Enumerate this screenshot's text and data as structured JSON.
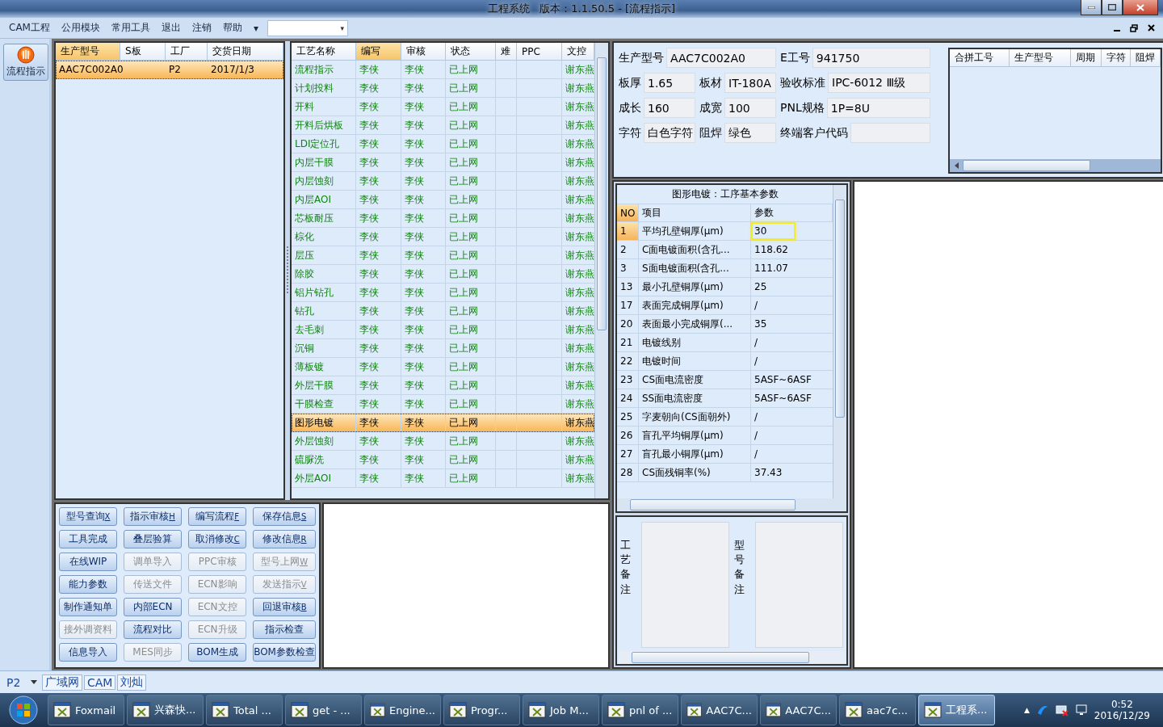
{
  "window": {
    "title": "工程系统   版本：1.1.50.5 - [流程指示]"
  },
  "menu": {
    "items": [
      "CAM工程",
      "公用模块",
      "常用工具",
      "退出",
      "注销",
      "帮助"
    ],
    "overflow": "▾",
    "combo_arrow": "▾"
  },
  "side_toolbar": {
    "button": "流程指示",
    "selected": true
  },
  "orders": {
    "columns": [
      "生产型号",
      "S板",
      "工厂",
      "交货日期"
    ],
    "rows": [
      {
        "cells": [
          "AAC7C002A0",
          "",
          "P2",
          "2017/1/3"
        ],
        "selected": true
      }
    ]
  },
  "processes": {
    "columns": [
      "工艺名称",
      "编写",
      "审核",
      "状态",
      "难",
      "PPC",
      "文控"
    ],
    "rows": [
      {
        "cells": [
          "流程指示",
          "李侠",
          "李侠",
          "已上网",
          "",
          "",
          "谢东燕"
        ],
        "selected": false
      },
      {
        "cells": [
          "计划投料",
          "李侠",
          "李侠",
          "已上网",
          "",
          "",
          "谢东燕"
        ],
        "selected": false
      },
      {
        "cells": [
          "开料",
          "李侠",
          "李侠",
          "已上网",
          "",
          "",
          "谢东燕"
        ],
        "selected": false
      },
      {
        "cells": [
          "开料后烘板",
          "李侠",
          "李侠",
          "已上网",
          "",
          "",
          "谢东燕"
        ],
        "selected": false
      },
      {
        "cells": [
          "LDI定位孔",
          "李侠",
          "李侠",
          "已上网",
          "",
          "",
          "谢东燕"
        ],
        "selected": false
      },
      {
        "cells": [
          "内层干膜",
          "李侠",
          "李侠",
          "已上网",
          "",
          "",
          "谢东燕"
        ],
        "selected": false
      },
      {
        "cells": [
          "内层蚀刻",
          "李侠",
          "李侠",
          "已上网",
          "",
          "",
          "谢东燕"
        ],
        "selected": false
      },
      {
        "cells": [
          "内层AOI",
          "李侠",
          "李侠",
          "已上网",
          "",
          "",
          "谢东燕"
        ],
        "selected": false
      },
      {
        "cells": [
          "芯板耐压",
          "李侠",
          "李侠",
          "已上网",
          "",
          "",
          "谢东燕"
        ],
        "selected": false
      },
      {
        "cells": [
          "棕化",
          "李侠",
          "李侠",
          "已上网",
          "",
          "",
          "谢东燕"
        ],
        "selected": false
      },
      {
        "cells": [
          "层压",
          "李侠",
          "李侠",
          "已上网",
          "",
          "",
          "谢东燕"
        ],
        "selected": false
      },
      {
        "cells": [
          "除胶",
          "李侠",
          "李侠",
          "已上网",
          "",
          "",
          "谢东燕"
        ],
        "selected": false
      },
      {
        "cells": [
          "铝片钻孔",
          "李侠",
          "李侠",
          "已上网",
          "",
          "",
          "谢东燕"
        ],
        "selected": false
      },
      {
        "cells": [
          "钻孔",
          "李侠",
          "李侠",
          "已上网",
          "",
          "",
          "谢东燕"
        ],
        "selected": false
      },
      {
        "cells": [
          "去毛刺",
          "李侠",
          "李侠",
          "已上网",
          "",
          "",
          "谢东燕"
        ],
        "selected": false
      },
      {
        "cells": [
          "沉铜",
          "李侠",
          "李侠",
          "已上网",
          "",
          "",
          "谢东燕"
        ],
        "selected": false
      },
      {
        "cells": [
          "薄板镀",
          "李侠",
          "李侠",
          "已上网",
          "",
          "",
          "谢东燕"
        ],
        "selected": false
      },
      {
        "cells": [
          "外层干膜",
          "李侠",
          "李侠",
          "已上网",
          "",
          "",
          "谢东燕"
        ],
        "selected": false
      },
      {
        "cells": [
          "干膜检查",
          "李侠",
          "李侠",
          "已上网",
          "",
          "",
          "谢东燕"
        ],
        "selected": false
      },
      {
        "cells": [
          "图形电镀",
          "李侠",
          "李侠",
          "已上网",
          "",
          "",
          "谢东燕"
        ],
        "selected": true
      },
      {
        "cells": [
          "外层蚀刻",
          "李侠",
          "李侠",
          "已上网",
          "",
          "",
          "谢东燕"
        ],
        "selected": false
      },
      {
        "cells": [
          "硫脲洗",
          "李侠",
          "李侠",
          "已上网",
          "",
          "",
          "谢东燕"
        ],
        "selected": false
      },
      {
        "cells": [
          "外层AOI",
          "李侠",
          "李侠",
          "已上网",
          "",
          "",
          "谢东燕"
        ],
        "selected": false
      }
    ]
  },
  "actions": [
    {
      "label": "型号查询",
      "hotkey": "X",
      "disabled": false
    },
    {
      "label": "指示审核",
      "hotkey": "H",
      "disabled": false
    },
    {
      "label": "编写流程",
      "hotkey": "F",
      "disabled": false
    },
    {
      "label": "保存信息",
      "hotkey": "S",
      "disabled": false
    },
    {
      "label": "工具完成",
      "disabled": false
    },
    {
      "label": "叠层验算",
      "disabled": false
    },
    {
      "label": "取消修改",
      "hotkey": "C",
      "disabled": false
    },
    {
      "label": "修改信息",
      "hotkey": "R",
      "disabled": false
    },
    {
      "label": "在线WIP",
      "disabled": false
    },
    {
      "label": "调单导入",
      "disabled": true
    },
    {
      "label": "PPC审核",
      "disabled": true
    },
    {
      "label": "型号上网",
      "hotkey": "W",
      "disabled": true
    },
    {
      "label": "能力参数",
      "disabled": false
    },
    {
      "label": "传送文件",
      "disabled": true
    },
    {
      "label": "ECN影响",
      "disabled": true
    },
    {
      "label": "发送指示",
      "hotkey": "V",
      "disabled": true
    },
    {
      "label": "制作通知单",
      "disabled": false
    },
    {
      "label": "内部ECN",
      "disabled": false
    },
    {
      "label": "ECN文控",
      "disabled": true
    },
    {
      "label": "回退审核",
      "hotkey": "B",
      "disabled": false
    },
    {
      "label": "接外调资料",
      "disabled": true
    },
    {
      "label": "流程对比",
      "disabled": false
    },
    {
      "label": "ECN升级",
      "disabled": true
    },
    {
      "label": "指示检查",
      "disabled": false
    },
    {
      "label": "信息导入",
      "disabled": false
    },
    {
      "label": "MES同步",
      "disabled": true
    },
    {
      "label": "BOM生成",
      "disabled": false
    },
    {
      "label": "BOM参数检查",
      "disabled": false
    }
  ],
  "info": {
    "rows": [
      [
        {
          "label": "生产型号",
          "value": "AAC7C002A0"
        },
        "",
        {
          "label": "E工号",
          "value": "941750"
        }
      ],
      [
        {
          "label": "板厚",
          "value": "1.65"
        },
        {
          "label": "板材",
          "value": "IT-180A"
        },
        {
          "label": "验收标准",
          "value": "IPC-6012 Ⅲ级"
        }
      ],
      [
        {
          "label": "成长",
          "value": "160"
        },
        {
          "label": "成宽",
          "value": "100"
        },
        {
          "label": "PNL规格",
          "value": "1P=8U"
        }
      ],
      [
        {
          "label": "字符",
          "value": "白色字符"
        },
        {
          "label": "阻焊",
          "value": "绿色"
        },
        {
          "label": "终端客户代码"
        }
      ]
    ]
  },
  "panel_grid": {
    "columns": [
      "合拼工号",
      "生产型号",
      "周期",
      "字符",
      "阻焊"
    ]
  },
  "params": {
    "title": "图形电镀：工序基本参数",
    "columns": [
      "NO",
      "项目",
      "参数"
    ],
    "rows": [
      {
        "no": "1",
        "item": "平均孔壁铜厚(μm)",
        "value": "30",
        "selected": true,
        "highlighted": true
      },
      {
        "no": "2",
        "item": "C面电镀面积(含孔...",
        "value": "118.62",
        "selected": false,
        "highlighted": false
      },
      {
        "no": "3",
        "item": "S面电镀面积(含孔...",
        "value": "111.07",
        "selected": false,
        "highlighted": false
      },
      {
        "no": "13",
        "item": "最小孔壁铜厚(μm)",
        "value": "25",
        "selected": false,
        "highlighted": false
      },
      {
        "no": "17",
        "item": "表面完成铜厚(μm)",
        "value": "/",
        "selected": false,
        "highlighted": false
      },
      {
        "no": "20",
        "item": "表面最小完成铜厚(...",
        "value": "35",
        "selected": false,
        "highlighted": false
      },
      {
        "no": "21",
        "item": "电镀线别",
        "value": "/",
        "selected": false,
        "highlighted": false
      },
      {
        "no": "22",
        "item": "电镀时间",
        "value": "/",
        "selected": false,
        "highlighted": false
      },
      {
        "no": "23",
        "item": "CS面电流密度",
        "value": "5ASF~6ASF",
        "selected": false,
        "highlighted": false
      },
      {
        "no": "24",
        "item": "SS面电流密度",
        "value": "5ASF~6ASF",
        "selected": false,
        "highlighted": false
      },
      {
        "no": "25",
        "item": "字麦朝向(CS面朝外)",
        "value": "/",
        "selected": false,
        "highlighted": false
      },
      {
        "no": "26",
        "item": "盲孔平均铜厚(μm)",
        "value": "/",
        "selected": false,
        "highlighted": false
      },
      {
        "no": "27",
        "item": "盲孔最小铜厚(μm)",
        "value": "/",
        "selected": false,
        "highlighted": false
      },
      {
        "no": "28",
        "item": "CS面残铜率(%)",
        "value": "37.43",
        "selected": false,
        "highlighted": false
      }
    ]
  },
  "remarks": [
    {
      "label": "工艺备注"
    },
    {
      "label": "型号备注"
    }
  ],
  "status_bar": {
    "factory": "P2",
    "tabs": [
      "广域网",
      "CAM",
      "刘灿"
    ]
  },
  "taskbar": {
    "items": [
      {
        "label": "Foxmail",
        "selected": false
      },
      {
        "label": "兴森快...",
        "selected": false
      },
      {
        "label": "Total ...",
        "selected": false
      },
      {
        "label": "get - ...",
        "selected": false
      },
      {
        "label": "Engine...",
        "selected": false
      },
      {
        "label": "Progr...",
        "selected": false
      },
      {
        "label": "Job M...",
        "selected": false
      },
      {
        "label": "pnl of ...",
        "selected": false
      },
      {
        "label": "AAC7C...",
        "selected": false
      },
      {
        "label": "AAC7C...",
        "selected": false
      },
      {
        "label": "aac7c...",
        "selected": false
      },
      {
        "label": "工程系...",
        "selected": true
      }
    ],
    "time": "0:52",
    "date": "2016/12/29",
    "tray_arrow": "▲"
  }
}
